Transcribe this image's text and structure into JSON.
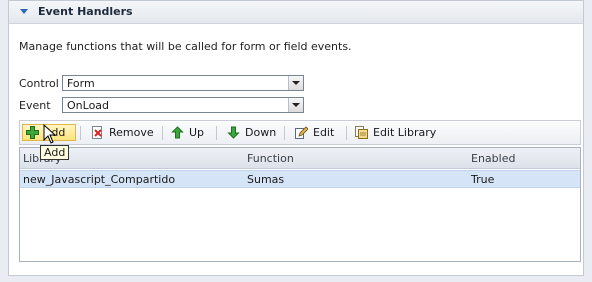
{
  "section": {
    "title": "Event Handlers"
  },
  "description": "Manage functions that will be called for form or field events.",
  "control": {
    "label": "Control",
    "value": "Form"
  },
  "event": {
    "label": "Event",
    "value": "OnLoad"
  },
  "toolbar": {
    "add": "Add",
    "remove": "Remove",
    "up": "Up",
    "down": "Down",
    "edit": "Edit",
    "edit_library": "Edit Library"
  },
  "grid": {
    "columns": [
      "Library",
      "Function",
      "Enabled"
    ],
    "rows": [
      [
        "new_Javascript_Compartido",
        "Sumas",
        "True"
      ]
    ]
  },
  "tooltip": "Add",
  "icons": {
    "collapse": "triangle-down-icon",
    "add": "green-plus-icon",
    "remove": "red-x-document-icon",
    "up": "green-up-arrow-icon",
    "down": "green-down-arrow-icon",
    "edit": "pencil-document-icon",
    "edit_library": "library-document-icon"
  },
  "colors": {
    "accent": "#3066b5",
    "selected_row": "#d6e4f7",
    "hover_button": "#ffe37a"
  }
}
